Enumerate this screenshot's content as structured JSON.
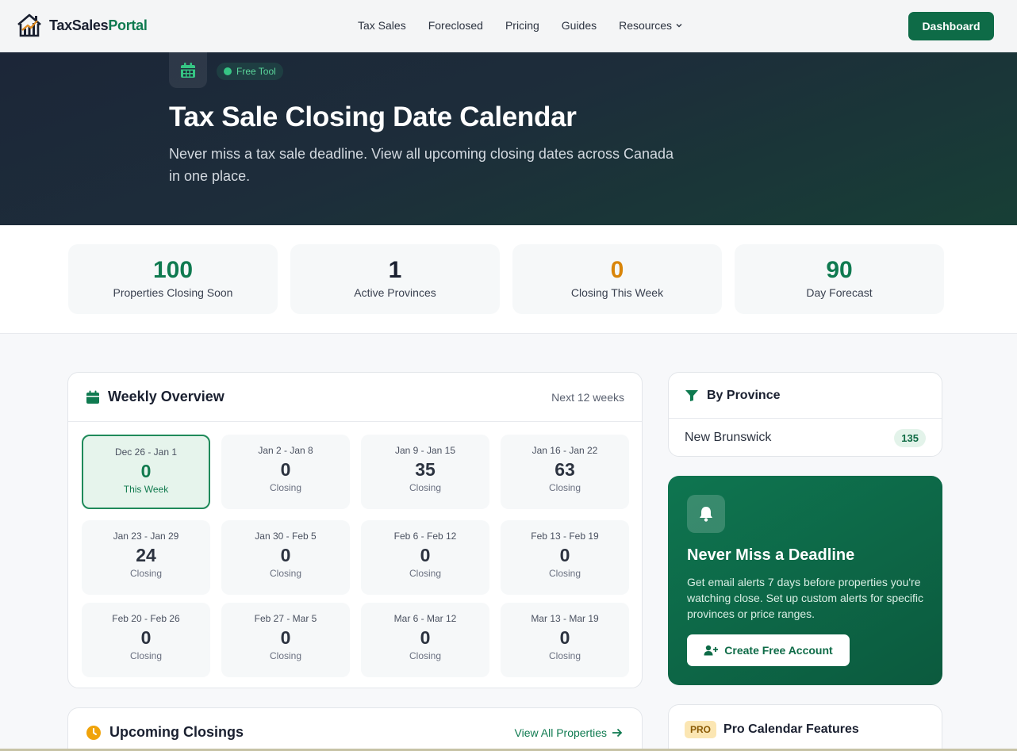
{
  "nav": {
    "brand_part1": "TaxSales",
    "brand_part2": "Portal",
    "links": [
      "Tax Sales",
      "Foreclosed",
      "Pricing",
      "Guides",
      "Resources"
    ],
    "dashboard_label": "Dashboard"
  },
  "hero": {
    "badge": "Free Tool",
    "title": "Tax Sale Closing Date Calendar",
    "subtitle": "Never miss a tax sale deadline. View all upcoming closing dates across Canada in one place."
  },
  "stats": [
    {
      "value": "100",
      "label": "Properties Closing Soon",
      "color": "#0f7a50"
    },
    {
      "value": "1",
      "label": "Active Provinces",
      "color": "#1a2030"
    },
    {
      "value": "0",
      "label": "Closing This Week",
      "color": "#d9850a"
    },
    {
      "value": "90",
      "label": "Day Forecast",
      "color": "#0f7a50"
    }
  ],
  "weekly": {
    "title": "Weekly Overview",
    "subtitle": "Next 12 weeks",
    "weeks": [
      {
        "range": "Dec 26 - Jan 1",
        "count": "0",
        "label": "This Week"
      },
      {
        "range": "Jan 2 - Jan 8",
        "count": "0",
        "label": "Closing"
      },
      {
        "range": "Jan 9 - Jan 15",
        "count": "35",
        "label": "Closing"
      },
      {
        "range": "Jan 16 - Jan 22",
        "count": "63",
        "label": "Closing"
      },
      {
        "range": "Jan 23 - Jan 29",
        "count": "24",
        "label": "Closing"
      },
      {
        "range": "Jan 30 - Feb 5",
        "count": "0",
        "label": "Closing"
      },
      {
        "range": "Feb 6 - Feb 12",
        "count": "0",
        "label": "Closing"
      },
      {
        "range": "Feb 13 - Feb 19",
        "count": "0",
        "label": "Closing"
      },
      {
        "range": "Feb 20 - Feb 26",
        "count": "0",
        "label": "Closing"
      },
      {
        "range": "Feb 27 - Mar 5",
        "count": "0",
        "label": "Closing"
      },
      {
        "range": "Mar 6 - Mar 12",
        "count": "0",
        "label": "Closing"
      },
      {
        "range": "Mar 13 - Mar 19",
        "count": "0",
        "label": "Closing"
      }
    ]
  },
  "upcoming": {
    "title": "Upcoming Closings",
    "link": "View All Properties"
  },
  "province": {
    "title": "By Province",
    "rows": [
      {
        "name": "New Brunswick",
        "count": "135"
      }
    ]
  },
  "alerts": {
    "title": "Never Miss a Deadline",
    "text": "Get email alerts 7 days before properties you're watching close. Set up custom alerts for specific provinces or price ranges.",
    "button": "Create Free Account"
  },
  "pro": {
    "badge": "PRO",
    "title": "Pro Calendar Features"
  },
  "icons": {
    "logo": "house-chart-logo",
    "hero": "calendar-icon",
    "weekly": "calendar-icon",
    "upcoming": "clock-icon",
    "province": "filter-icon",
    "alerts": "bell-icon",
    "create": "user-plus-icon",
    "link": "arrow-right-icon",
    "resources": "chevron-down-icon"
  }
}
